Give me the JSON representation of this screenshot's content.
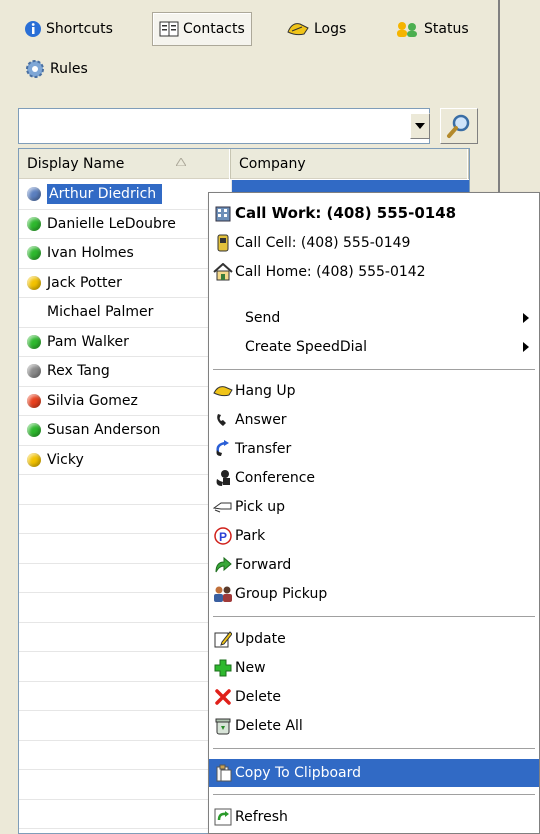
{
  "toolbar": {
    "shortcuts": "Shortcuts",
    "contacts": "Contacts",
    "logs": "Logs",
    "status": "Status",
    "rules": "Rules"
  },
  "search": {
    "value": "",
    "placeholder": ""
  },
  "list": {
    "columns": [
      "Display Name",
      "Company"
    ],
    "rows": [
      {
        "name": "Arthur Diedrich",
        "status_color": "#5b7fbf",
        "selected": true
      },
      {
        "name": "Danielle LeDoubre",
        "status_color": "#2eb82e"
      },
      {
        "name": "Ivan Holmes",
        "status_color": "#2eb82e"
      },
      {
        "name": "Jack  Potter",
        "status_color": "#f2c200"
      },
      {
        "name": "Michael Palmer",
        "status_color": null
      },
      {
        "name": "Pam Walker",
        "status_color": "#2eb82e"
      },
      {
        "name": "Rex Tang",
        "status_color": "#8a8a8a"
      },
      {
        "name": "Silvia Gomez",
        "status_color": "#e8411e"
      },
      {
        "name": "Susan Anderson",
        "status_color": "#2eb82e"
      },
      {
        "name": "Vicky",
        "status_color": "#f2c200"
      }
    ]
  },
  "menu": {
    "call_work": "Call Work: (408) 555-0148",
    "call_cell": "Call Cell: (408) 555-0149",
    "call_home": "Call Home: (408) 555-0142",
    "send": "Send",
    "create_speeddial": "Create SpeedDial",
    "hang_up": "Hang Up",
    "answer": "Answer",
    "transfer": "Transfer",
    "conference": "Conference",
    "pick_up": "Pick up",
    "park": "Park",
    "forward": "Forward",
    "group_pickup": "Group Pickup",
    "update": "Update",
    "new": "New",
    "delete": "Delete",
    "delete_all": "Delete All",
    "copy_to_clipboard": "Copy To Clipboard",
    "refresh": "Refresh"
  },
  "colors": {
    "selection": "#316ac5",
    "window_bg": "#ece9d8"
  }
}
